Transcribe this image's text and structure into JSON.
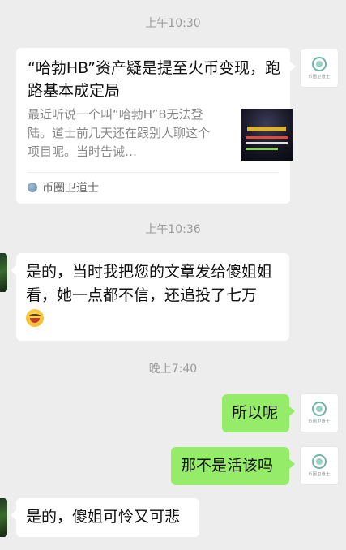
{
  "chat": {
    "timestamps": [
      "上午10:30",
      "上午10:36",
      "晚上7:40"
    ],
    "link_card": {
      "title": "“哈勃HB”资产疑是提至火币变现，跑路基本成定局",
      "description": "最近听说一个叫“哈勃H”B无法登陆。道士前几天还在跟别人聊这个项目呢。当时告诫…",
      "source": "币圈卫道士",
      "thumbnail_icon": "article-thumbnail-image"
    },
    "messages": [
      {
        "side": "left",
        "text": "是的，当时我把您的文章发给傻姐姐看，她一点都不信，还追投了七万",
        "emoji": "grimacing-tears-emoji"
      },
      {
        "side": "right",
        "text": "所以呢"
      },
      {
        "side": "right",
        "text": "那不是活该吗"
      },
      {
        "side": "left",
        "text": "是的，傻姐可怜又可悲"
      }
    ],
    "self_avatar_caption": "币圈卫道士",
    "colors": {
      "background": "#ededed",
      "outgoing_bubble": "#95ec69",
      "incoming_bubble": "#ffffff",
      "timestamp_text": "#9a9a9a"
    }
  }
}
